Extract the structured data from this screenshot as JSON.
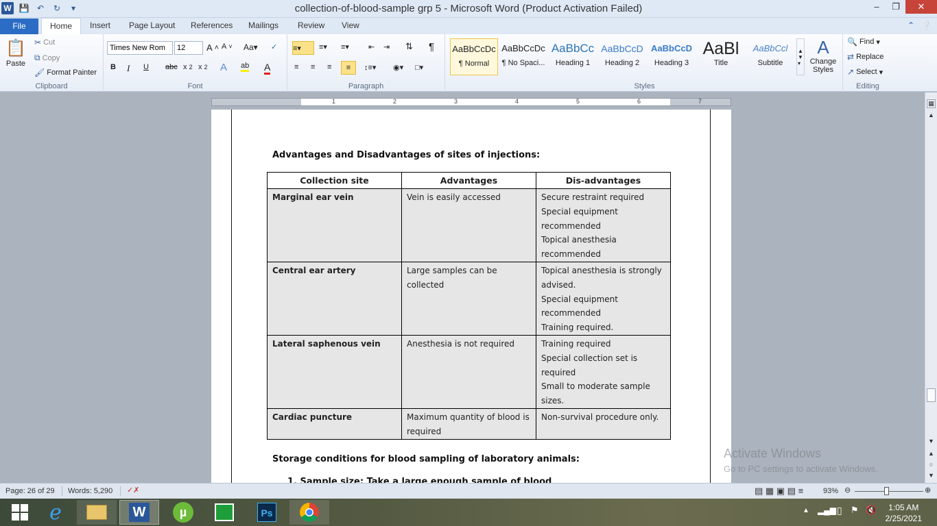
{
  "titlebar": {
    "title": "collection-of-blood-sample grp 5  -  Microsoft Word (Product Activation Failed)",
    "logo": "W"
  },
  "tabs": {
    "file": "File",
    "items": [
      "Home",
      "Insert",
      "Page Layout",
      "References",
      "Mailings",
      "Review",
      "View"
    ]
  },
  "ribbon": {
    "clipboard": {
      "paste": "Paste",
      "cut": "Cut",
      "copy": "Copy",
      "format_painter": "Format Painter",
      "label": "Clipboard"
    },
    "font": {
      "name": "Times New Rom",
      "size": "12",
      "label": "Font"
    },
    "paragraph": {
      "label": "Paragraph"
    },
    "styles": {
      "items": [
        {
          "preview": "AaBbCcDc",
          "name": "¶ Normal"
        },
        {
          "preview": "AaBbCcDc",
          "name": "¶ No Spaci..."
        },
        {
          "preview": "AaBbCc",
          "name": "Heading 1"
        },
        {
          "preview": "AaBbCcD",
          "name": "Heading 2"
        },
        {
          "preview": "AaBbCcD",
          "name": "Heading 3"
        },
        {
          "preview": "AaBl",
          "name": "Title"
        },
        {
          "preview": "AaBbCcl",
          "name": "Subtitle"
        }
      ],
      "change_styles": "Change Styles",
      "label": "Styles"
    },
    "editing": {
      "find": "Find",
      "replace": "Replace",
      "select": "Select",
      "label": "Editing"
    }
  },
  "ruler": {
    "numbers": [
      "1",
      "2",
      "3",
      "4",
      "5",
      "6",
      "7"
    ]
  },
  "document": {
    "heading1": "Advantages and Disadvantages of sites of injections:",
    "table": {
      "headers": [
        "Collection site",
        "Advantages",
        "Dis-advantages"
      ],
      "rows": [
        {
          "site": "Marginal ear vein",
          "advantages": [
            "Vein is easily accessed"
          ],
          "disadvantages": [
            "Secure restraint required",
            "Special equipment recommended",
            "Topical anesthesia recommended"
          ]
        },
        {
          "site": "Central ear artery",
          "advantages": [
            "Large samples can be collected"
          ],
          "disadvantages": [
            "Topical anesthesia is strongly advised.",
            "Special equipment recommended",
            "Training required."
          ]
        },
        {
          "site": "Lateral saphenous vein",
          "advantages": [
            "Anesthesia is not required"
          ],
          "disadvantages": [
            "Training required",
            "Special collection set is required",
            "Small to moderate sample sizes."
          ]
        },
        {
          "site": "Cardiac puncture",
          "advantages": [
            "Maximum quantity of blood is required"
          ],
          "disadvantages": [
            "Non-survival procedure only."
          ]
        }
      ]
    },
    "heading2": "Storage conditions for blood sampling of laboratory animals:",
    "list_item": "1.   Sample size: Take a large enough sample of blood"
  },
  "watermark": {
    "line1": "Activate Windows",
    "line2": "Go to PC settings to activate Windows."
  },
  "status": {
    "page": "Page: 26 of 29",
    "words": "Words: 5,290",
    "zoom": "93%",
    "zoom_level_percent": 93
  },
  "taskbar": {
    "time": "1:05 AM",
    "date": "2/25/2021"
  },
  "colors": {
    "accent": "#2b579a",
    "file_tab": "#2b6cc4",
    "table_fill": "#e6e6e6",
    "close": "#c7443a"
  }
}
